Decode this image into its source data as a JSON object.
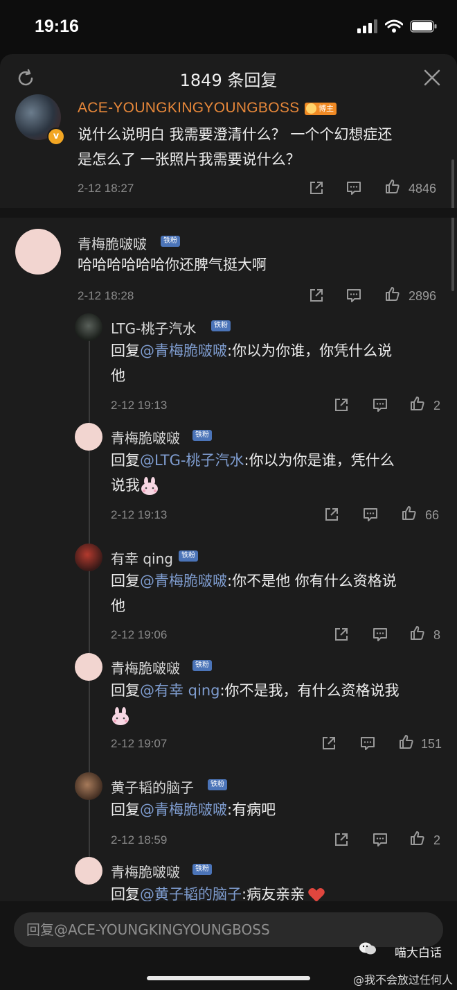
{
  "status_bar": {
    "time": "19:16"
  },
  "header": {
    "title": "1849 条回复"
  },
  "main_comment": {
    "author": "ACE-YOUNGKINGYOUNGBOSS",
    "author_badge": "博主",
    "text_line1": "说什么说明白 我需要澄清什么？ 一个个幻想症还",
    "text_line2": "是怎么了 一张照片我需要说什么？",
    "time": "2-12 18:27",
    "likes": "4846"
  },
  "comment2": {
    "author": "青梅脆啵啵",
    "badge": "铁粉",
    "text": "哈哈哈哈哈哈你还脾气挺大啊",
    "time": "2-12 18:28",
    "likes": "2896"
  },
  "replies": [
    {
      "author": "LTG-桃子汽水",
      "badge": "铁粉",
      "prefix": "回复",
      "mention": "@青梅脆啵啵",
      "text_line1": ":你以为你谁，你凭什么说",
      "text_line2": "他",
      "time": "2-12 19:13",
      "likes": "2"
    },
    {
      "author": "青梅脆啵啵",
      "badge": "铁粉",
      "prefix": "回复",
      "mention": "@LTG-桃子汽水",
      "text_line1": ":你以为你是谁，凭什么",
      "text_line2": "说我",
      "time": "2-12 19:13",
      "likes": "66"
    },
    {
      "author": "有幸 qing",
      "badge": "铁粉",
      "prefix": "回复",
      "mention": "@青梅脆啵啵",
      "text_line1": ":你不是他 你有什么资格说",
      "text_line2": "他",
      "time": "2-12 19:06",
      "likes": "8"
    },
    {
      "author": "青梅脆啵啵",
      "badge": "铁粉",
      "prefix": "回复",
      "mention": "@有幸 qing",
      "text_line1": ":你不是我，有什么资格说我",
      "text_line2": "",
      "time": "2-12 19:07",
      "likes": "151"
    },
    {
      "author": "黄子韬的脑子",
      "badge": "铁粉",
      "prefix": "回复",
      "mention": "@青梅脆啵啵",
      "text_line1": ":有病吧",
      "text_line2": "",
      "time": "2-12 18:59",
      "likes": "2"
    },
    {
      "author": "青梅脆啵啵",
      "badge": "铁粉",
      "prefix": "回复",
      "mention": "@黄子韬的脑子",
      "text_line1": ":病友亲亲",
      "text_line2": "",
      "time": "",
      "likes": ""
    }
  ],
  "reply_input": {
    "placeholder": "回复@ACE-YOUNGKINGYOUNGBOSS"
  },
  "watermark": {
    "line1": "喵大白话",
    "line2": "@我不会放过任何人"
  },
  "colors": {
    "background": "#1c1c1c",
    "mention": "#7f9dd0",
    "author_highlight": "#e8883a",
    "badge": "#4b74b8"
  }
}
